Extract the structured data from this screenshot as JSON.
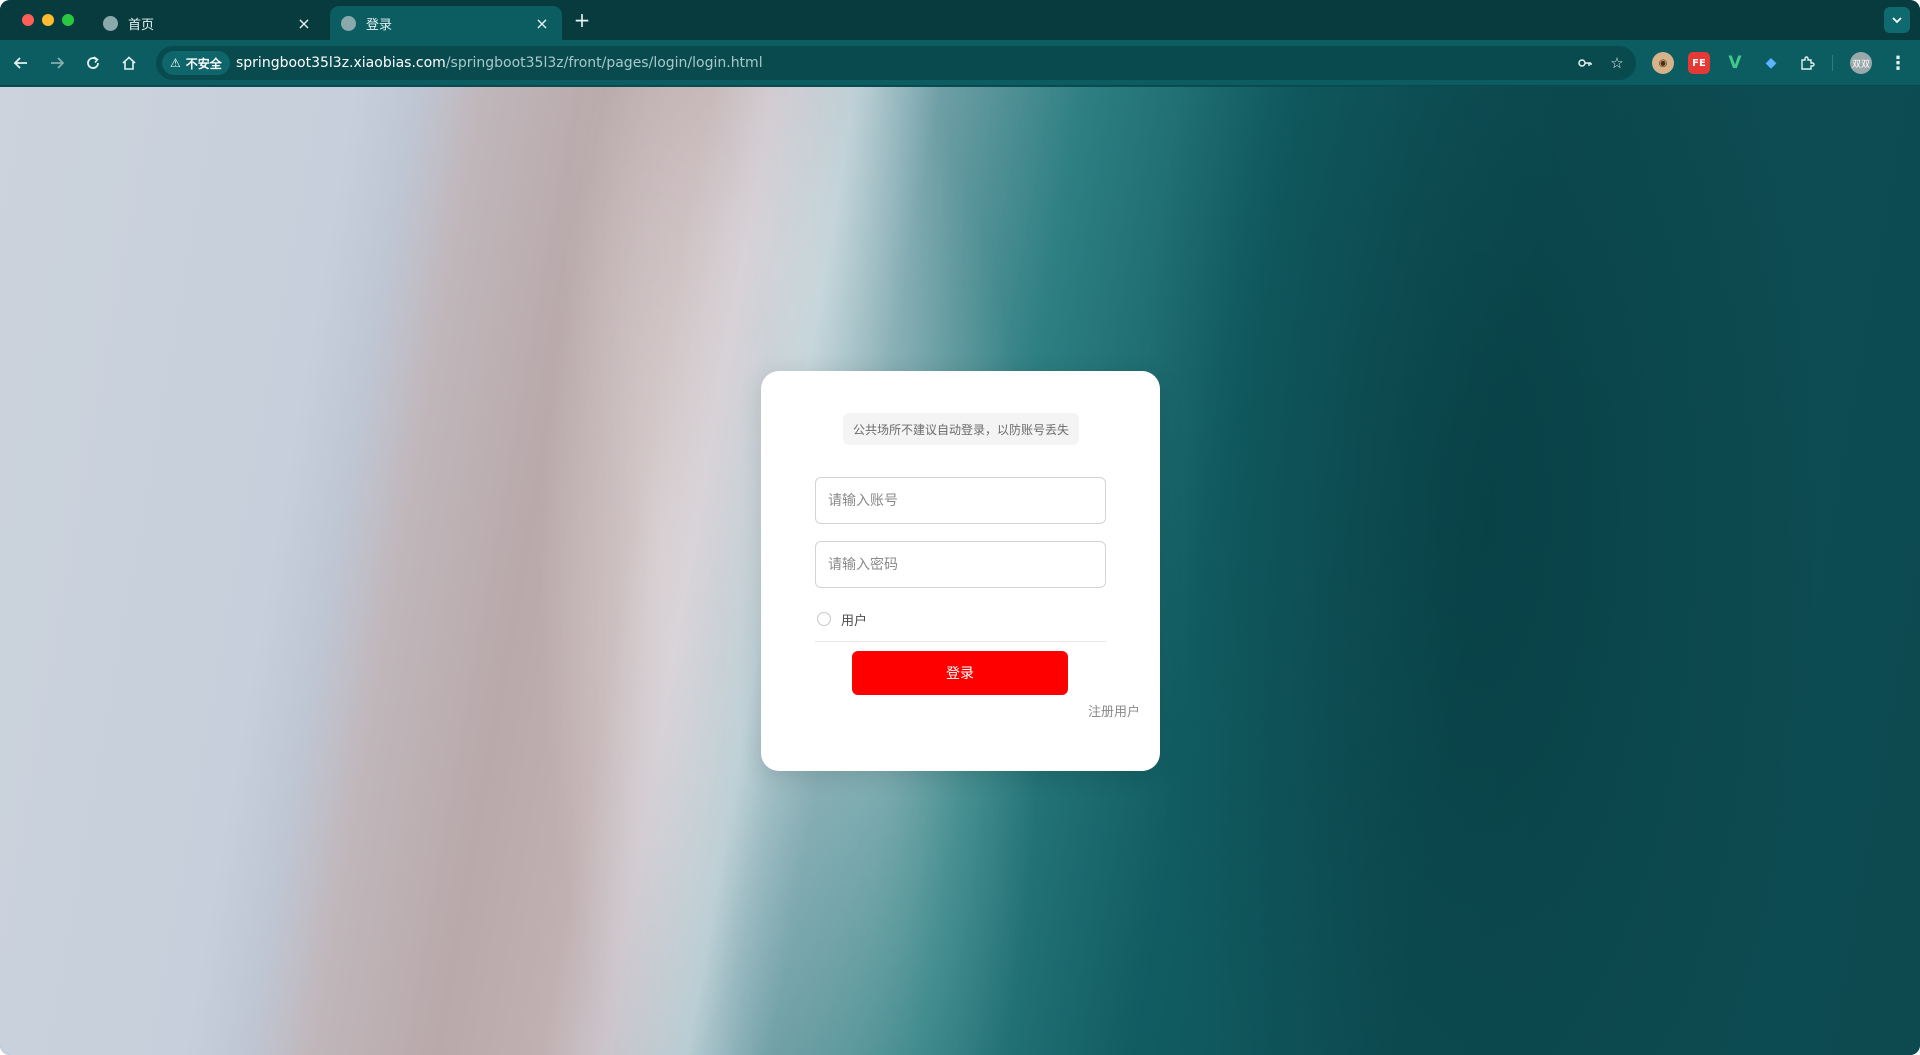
{
  "browser": {
    "tabs": [
      {
        "title": "首页",
        "active": false
      },
      {
        "title": "登录",
        "active": true
      }
    ],
    "new_tab_symbol": "+",
    "close_symbol": "×",
    "security_label": "不安全",
    "url_host": "springboot35l3z.xiaobias.com",
    "url_path": "/springboot35l3z/front/pages/login/login.html",
    "profile_label": "双双",
    "extension_labels": {
      "fe": "FE",
      "vue": "V"
    },
    "icons": [
      "back-icon",
      "forward-icon",
      "reload-icon",
      "home-icon",
      "warning-icon",
      "key-icon",
      "star-icon",
      "extensions-icon",
      "menu-icon",
      "globe-icon"
    ]
  },
  "login": {
    "tip": "公共场所不建议自动登录，以防账号丢失",
    "account_placeholder": "请输入账号",
    "password_placeholder": "请输入密码",
    "role_label": "用户",
    "login_button": "登录",
    "register_link": "注册用户"
  },
  "colors": {
    "login_button": "#ff0000",
    "browser_chrome": "#0b5d62"
  }
}
